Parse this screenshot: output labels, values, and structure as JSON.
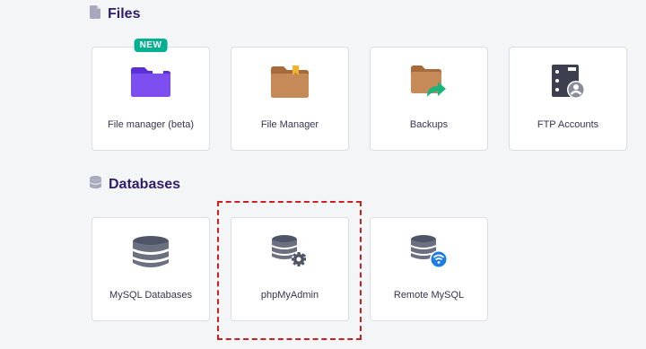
{
  "files": {
    "title": "Files",
    "cards": [
      {
        "label": "File manager (beta)",
        "badge": "NEW",
        "icon": "folder-purple-icon"
      },
      {
        "label": "File Manager",
        "icon": "folder-brown-icon"
      },
      {
        "label": "Backups",
        "icon": "backup-folder-icon"
      },
      {
        "label": "FTP Accounts",
        "icon": "ftp-server-icon"
      }
    ]
  },
  "databases": {
    "title": "Databases",
    "cards": [
      {
        "label": "MySQL Databases",
        "icon": "database-icon"
      },
      {
        "label": "phpMyAdmin",
        "icon": "database-gear-icon"
      },
      {
        "label": "Remote MySQL",
        "icon": "database-wifi-icon"
      }
    ]
  },
  "colors": {
    "accent": "#673de6",
    "heading": "#2f1c6a",
    "badge": "#00b090",
    "highlight": "#cc1f1f"
  }
}
